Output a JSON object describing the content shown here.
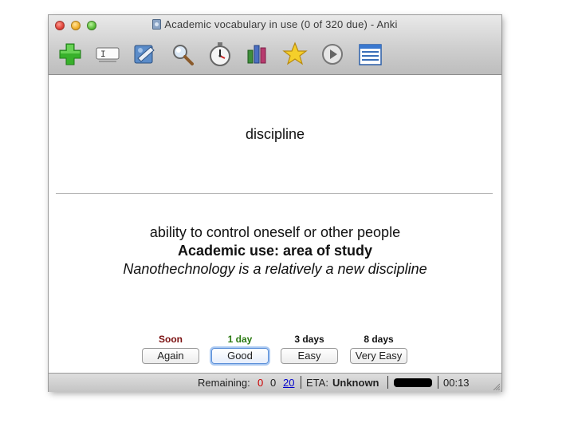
{
  "window": {
    "title": "Academic vocabulary in use (0 of 320 due) - Anki"
  },
  "toolbar": {
    "items": [
      {
        "name": "add-icon"
      },
      {
        "name": "edit-field-icon"
      },
      {
        "name": "deck-browser-icon"
      },
      {
        "name": "search-icon"
      },
      {
        "name": "timer-icon"
      },
      {
        "name": "statistics-icon"
      },
      {
        "name": "star-icon"
      },
      {
        "name": "play-icon"
      },
      {
        "name": "list-icon"
      }
    ],
    "edit_field_glyph": "I"
  },
  "card": {
    "question": "discipline",
    "answer_definition": "ability to control oneself or other people",
    "answer_use": "Academic use: area of study",
    "answer_example": "Nanothechnology is a relatively a new discipline"
  },
  "answer_buttons": [
    {
      "interval": "Soon",
      "label": "Again",
      "interval_color": "#7a0f0f"
    },
    {
      "interval": "1 day",
      "label": "Good",
      "interval_color": "#2b7a12"
    },
    {
      "interval": "3 days",
      "label": "Easy",
      "interval_color": "#111111"
    },
    {
      "interval": "8 days",
      "label": "Very Easy",
      "interval_color": "#111111"
    }
  ],
  "status": {
    "remaining_label": "Remaining:",
    "failed": "0",
    "review": "0",
    "new": "20",
    "eta_label": "ETA:",
    "eta_value": "Unknown",
    "time": "00:13",
    "colors": {
      "failed": "#cc0000",
      "new": "#0000cc"
    }
  }
}
